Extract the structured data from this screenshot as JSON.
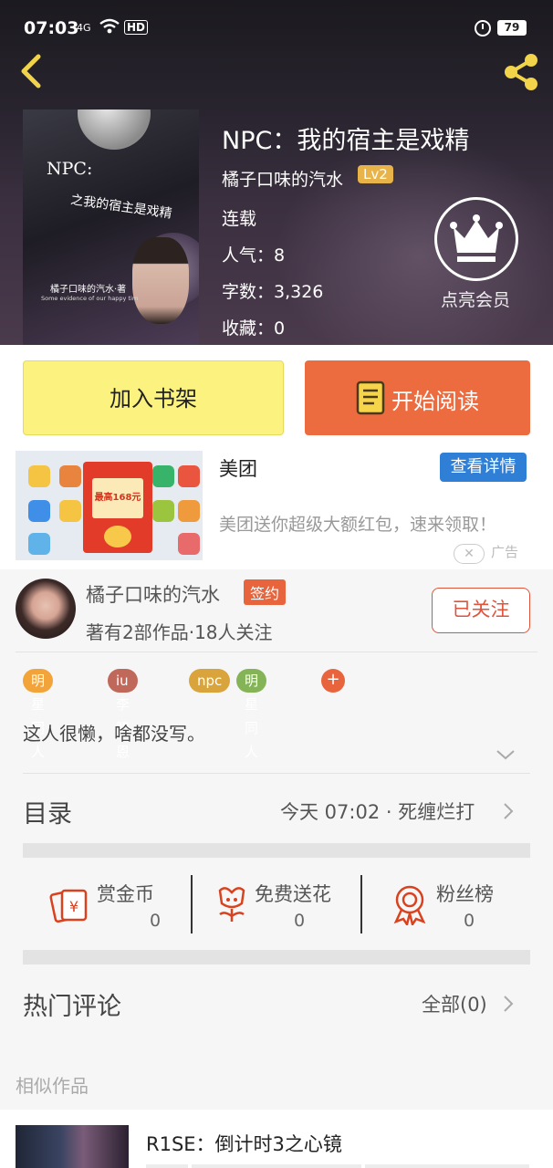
{
  "status_bar": {
    "time": "07:03",
    "network": "4G",
    "hd": "HD",
    "battery": "79"
  },
  "book": {
    "title": "NPC：我的宿主是戏精",
    "author": "橘子口味的汽水",
    "level": "Lv2",
    "status": "连载",
    "popularity": "人气：8",
    "word_count": "字数：3,326",
    "favorites": "收藏：0",
    "vip_label": "点亮会员",
    "cover": {
      "title_line1": "NPC:",
      "title_line2": "之我的宿主是戏精",
      "author_text": "橘子口味的汽水·著",
      "subtitle": "Some evidence of our happy tim"
    }
  },
  "actions": {
    "add_shelf": "加入书架",
    "start_read": "开始阅读"
  },
  "ad": {
    "title": "美团",
    "detail_button": "查看详情",
    "description": "美团送你超级大额红包，速来领取！",
    "close": "✕",
    "tag": "广告",
    "image_amount": "最高168元红包"
  },
  "author_section": {
    "name": "橘子口味的汽水",
    "sign_badge": "签约",
    "meta": "著有2部作品·18人关注",
    "follow_button": "已关注",
    "tags": [
      {
        "label": "明星同人",
        "color": "#f2a33a"
      },
      {
        "label": "iu李智恩",
        "color": "#c0685a"
      },
      {
        "label": "npc",
        "color": "#d9a43c"
      },
      {
        "label": "明星同人",
        "color": "#84b457"
      }
    ],
    "tag_more": "+",
    "bio": "这人很懒，啥都没写。"
  },
  "toc": {
    "title": "目录",
    "latest": "今天 07:02 · 死缠烂打"
  },
  "stats": [
    {
      "label": "赏金币",
      "value": "0",
      "icon": "reward-coin-icon"
    },
    {
      "label": "免费送花",
      "value": "0",
      "icon": "flower-icon"
    },
    {
      "label": "粉丝榜",
      "value": "0",
      "icon": "medal-icon"
    }
  ],
  "comments": {
    "title": "热门评论",
    "all_link": "全部(0)"
  },
  "similar": {
    "heading": "相似作品",
    "items": [
      {
        "title": "R1SE：倒计时3之心镜"
      }
    ]
  },
  "colors": {
    "accent_orange": "#ec6b3f",
    "shelf_yellow": "#fbf280",
    "link_blue": "#2f7fd6",
    "badge_gold": "#e8b44a"
  }
}
